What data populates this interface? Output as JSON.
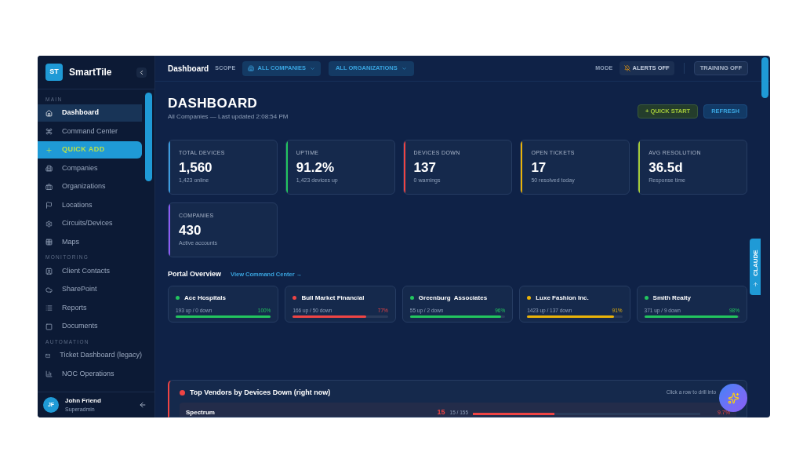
{
  "sidebar": {
    "logo": "ST",
    "app_name": "SmartTile",
    "sections": [
      {
        "title": "MAIN",
        "items": [
          {
            "label": "Dashboard",
            "kind": "link",
            "selected": true
          },
          {
            "label": "Command Center",
            "kind": "link",
            "selected": false
          },
          {
            "label": "QUICK ADD",
            "kind": "action",
            "selected": false
          },
          {
            "label": "Companies",
            "kind": "link",
            "selected": false
          },
          {
            "label": "Organizations",
            "kind": "link",
            "selected": false
          },
          {
            "label": "Locations",
            "kind": "link",
            "selected": false
          },
          {
            "label": "Circuits/Devices",
            "kind": "link",
            "selected": false
          },
          {
            "label": "Maps",
            "kind": "link",
            "selected": false
          }
        ]
      },
      {
        "title": "MONITORING",
        "items": [
          {
            "label": "Client Contacts",
            "kind": "link",
            "selected": false
          },
          {
            "label": "SharePoint",
            "kind": "link",
            "selected": false
          },
          {
            "label": "Reports",
            "kind": "link",
            "selected": false
          },
          {
            "label": "Documents",
            "kind": "link",
            "selected": false
          }
        ]
      },
      {
        "title": "AUTOMATION",
        "items": [
          {
            "label": "Ticket Dashboard (legacy)",
            "kind": "link",
            "selected": false
          },
          {
            "label": "NOC Operations",
            "kind": "link",
            "selected": false
          }
        ]
      }
    ],
    "user": {
      "initials": "JF",
      "name": "John Friend",
      "role": "Superadmin"
    }
  },
  "topbar": {
    "title": "Dashboard",
    "scope_label": "SCOPE",
    "company_filter": "ALL COMPANIES",
    "org_filter": "ALL ORGANIZATIONS",
    "mode_label": "MODE",
    "alerts": "ALERTS OFF",
    "training": "TRAINING OFF"
  },
  "header": {
    "title": "DASHBOARD",
    "subtitle": "All Companies — Last updated 2:08:54 PM",
    "quick_start": "+ QUICK START",
    "refresh": "REFRESH"
  },
  "stats": [
    {
      "label": "TOTAL DEVICES",
      "value": "1,560",
      "note": "1,423 online",
      "color": "#3b9be0"
    },
    {
      "label": "UPTIME",
      "value": "91.2%",
      "note": "1,423 devices up",
      "color": "#22c55e"
    },
    {
      "label": "DEVICES DOWN",
      "value": "137",
      "note": "0 warnings",
      "color": "#ef4444"
    },
    {
      "label": "OPEN TICKETS",
      "value": "17",
      "note": "50 resolved today",
      "color": "#eab308"
    },
    {
      "label": "AVG RESOLUTION",
      "value": "36.5d",
      "note": "Response time",
      "color": "#a3c93a"
    },
    {
      "label": "COMPANIES",
      "value": "430",
      "note": "Active accounts",
      "color": "#8b5cf6"
    }
  ],
  "portal_overview": {
    "title": "Portal Overview",
    "link": "View Command Center →",
    "portals": [
      {
        "name": "Ace Hospitals",
        "counts": "193 up / 0 down",
        "percent": "100%",
        "level": 1,
        "color": "#22c55e"
      },
      {
        "name": "Bull Market Financial",
        "counts": "166 up / 50 down",
        "percent": "77%",
        "level": 0.77,
        "color": "#ef4444"
      },
      {
        "name": "Greenburg  Associates",
        "counts": "55 up / 2 down",
        "percent": "96%",
        "level": 0.96,
        "color": "#22c55e"
      },
      {
        "name": "Luxe Fashion Inc.",
        "counts": "1423 up / 137 down",
        "percent": "91%",
        "level": 0.91,
        "color": "#eab308"
      },
      {
        "name": "Smith Realty",
        "counts": "371 up / 9 down",
        "percent": "98%",
        "level": 0.98,
        "color": "#22c55e"
      }
    ]
  },
  "top_vendors": {
    "title": "Top Vendors by Devices Down (right now)",
    "hint": "Click a row to drill into",
    "rows": [
      {
        "name": "Spectrum",
        "down": "15",
        "ratio": "15 / 155",
        "level": 0.36,
        "percent": "9.7%"
      }
    ]
  },
  "side_tab": "CLAUDE"
}
